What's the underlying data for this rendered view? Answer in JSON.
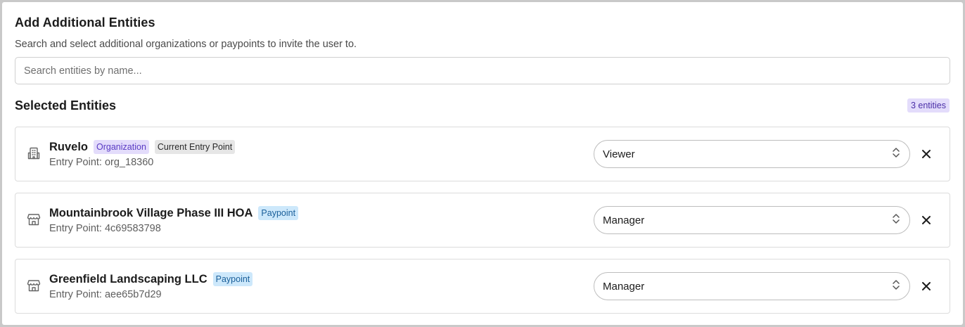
{
  "header": {
    "title": "Add Additional Entities",
    "subtitle": "Search and select additional organizations or paypoints to invite the user to."
  },
  "search": {
    "placeholder": "Search entities by name...",
    "value": ""
  },
  "selected": {
    "title": "Selected Entities",
    "count_label": "3 entities",
    "items": [
      {
        "name": "Ruvelo",
        "icon": "building-icon",
        "tags": [
          "Organization",
          "Current Entry Point"
        ],
        "entry_point": "Entry Point: org_18360",
        "role": "Viewer"
      },
      {
        "name": "Mountainbrook Village Phase III HOA",
        "icon": "store-icon",
        "tags": [
          "Paypoint"
        ],
        "entry_point": "Entry Point: 4c69583798",
        "role": "Manager"
      },
      {
        "name": "Greenfield Landscaping LLC",
        "icon": "store-icon",
        "tags": [
          "Paypoint"
        ],
        "entry_point": "Entry Point: aee65b7d29",
        "role": "Manager"
      }
    ]
  },
  "colors": {
    "organization_tag_bg": "#e3dcfb",
    "organization_tag_fg": "#5a3bc4",
    "paypoint_tag_bg": "#cde8fb",
    "paypoint_tag_fg": "#1a5f9a",
    "current_tag_bg": "#e6e6e6"
  }
}
